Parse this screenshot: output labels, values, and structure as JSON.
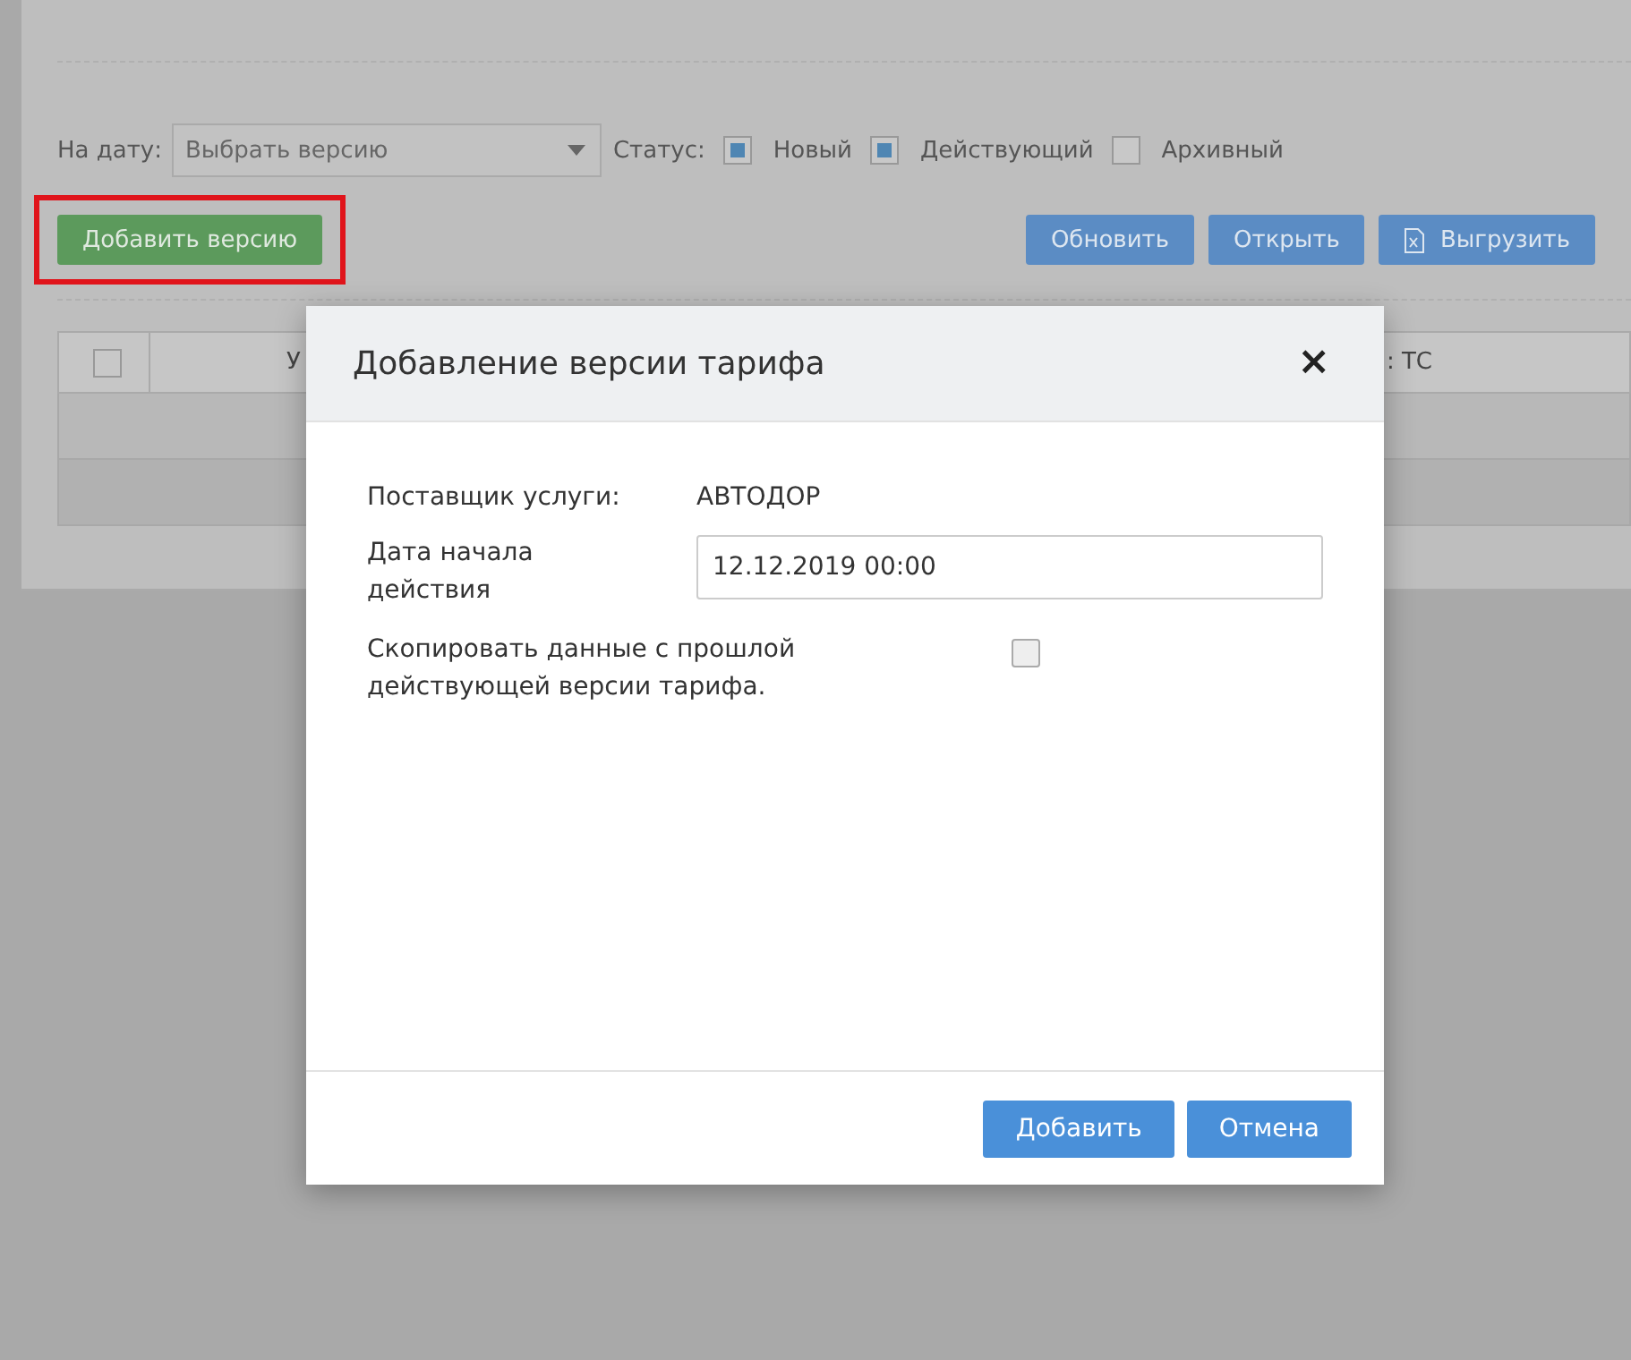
{
  "filters": {
    "date_label": "На дату:",
    "date_select": {
      "placeholder": "Выбрать версию"
    },
    "status_label": "Статус:",
    "statuses": [
      {
        "label": "Новый",
        "checked": true
      },
      {
        "label": "Действующий",
        "checked": true
      },
      {
        "label": "Архивный",
        "checked": false
      }
    ]
  },
  "toolbar": {
    "add_button": {
      "label": "Добавить версию",
      "highlighted": true
    },
    "buttons": [
      {
        "label": "Обновить",
        "kind": "plain"
      },
      {
        "label": "Открыть",
        "kind": "plain"
      },
      {
        "label": "Выгрузить",
        "kind": "export"
      }
    ]
  },
  "table": {
    "header_checked": false,
    "columns": [
      "У",
      ": ТС"
    ]
  },
  "dialog": {
    "title": "Добавление версии тарифа",
    "close": "×",
    "fields": [
      {
        "kind": "text",
        "label": "Поставщик услуги:",
        "value": "АВТОДОР"
      },
      {
        "kind": "input",
        "label": "Дата начала действия",
        "value": "12.12.2019 00:00"
      },
      {
        "kind": "checkbox",
        "label": "Скопировать данные с прошлой действующей версии тарифа.",
        "checked": false
      }
    ],
    "buttons": [
      {
        "label": "Добавить",
        "kind": "primary"
      },
      {
        "label": "Отмена",
        "kind": "primary"
      }
    ]
  }
}
